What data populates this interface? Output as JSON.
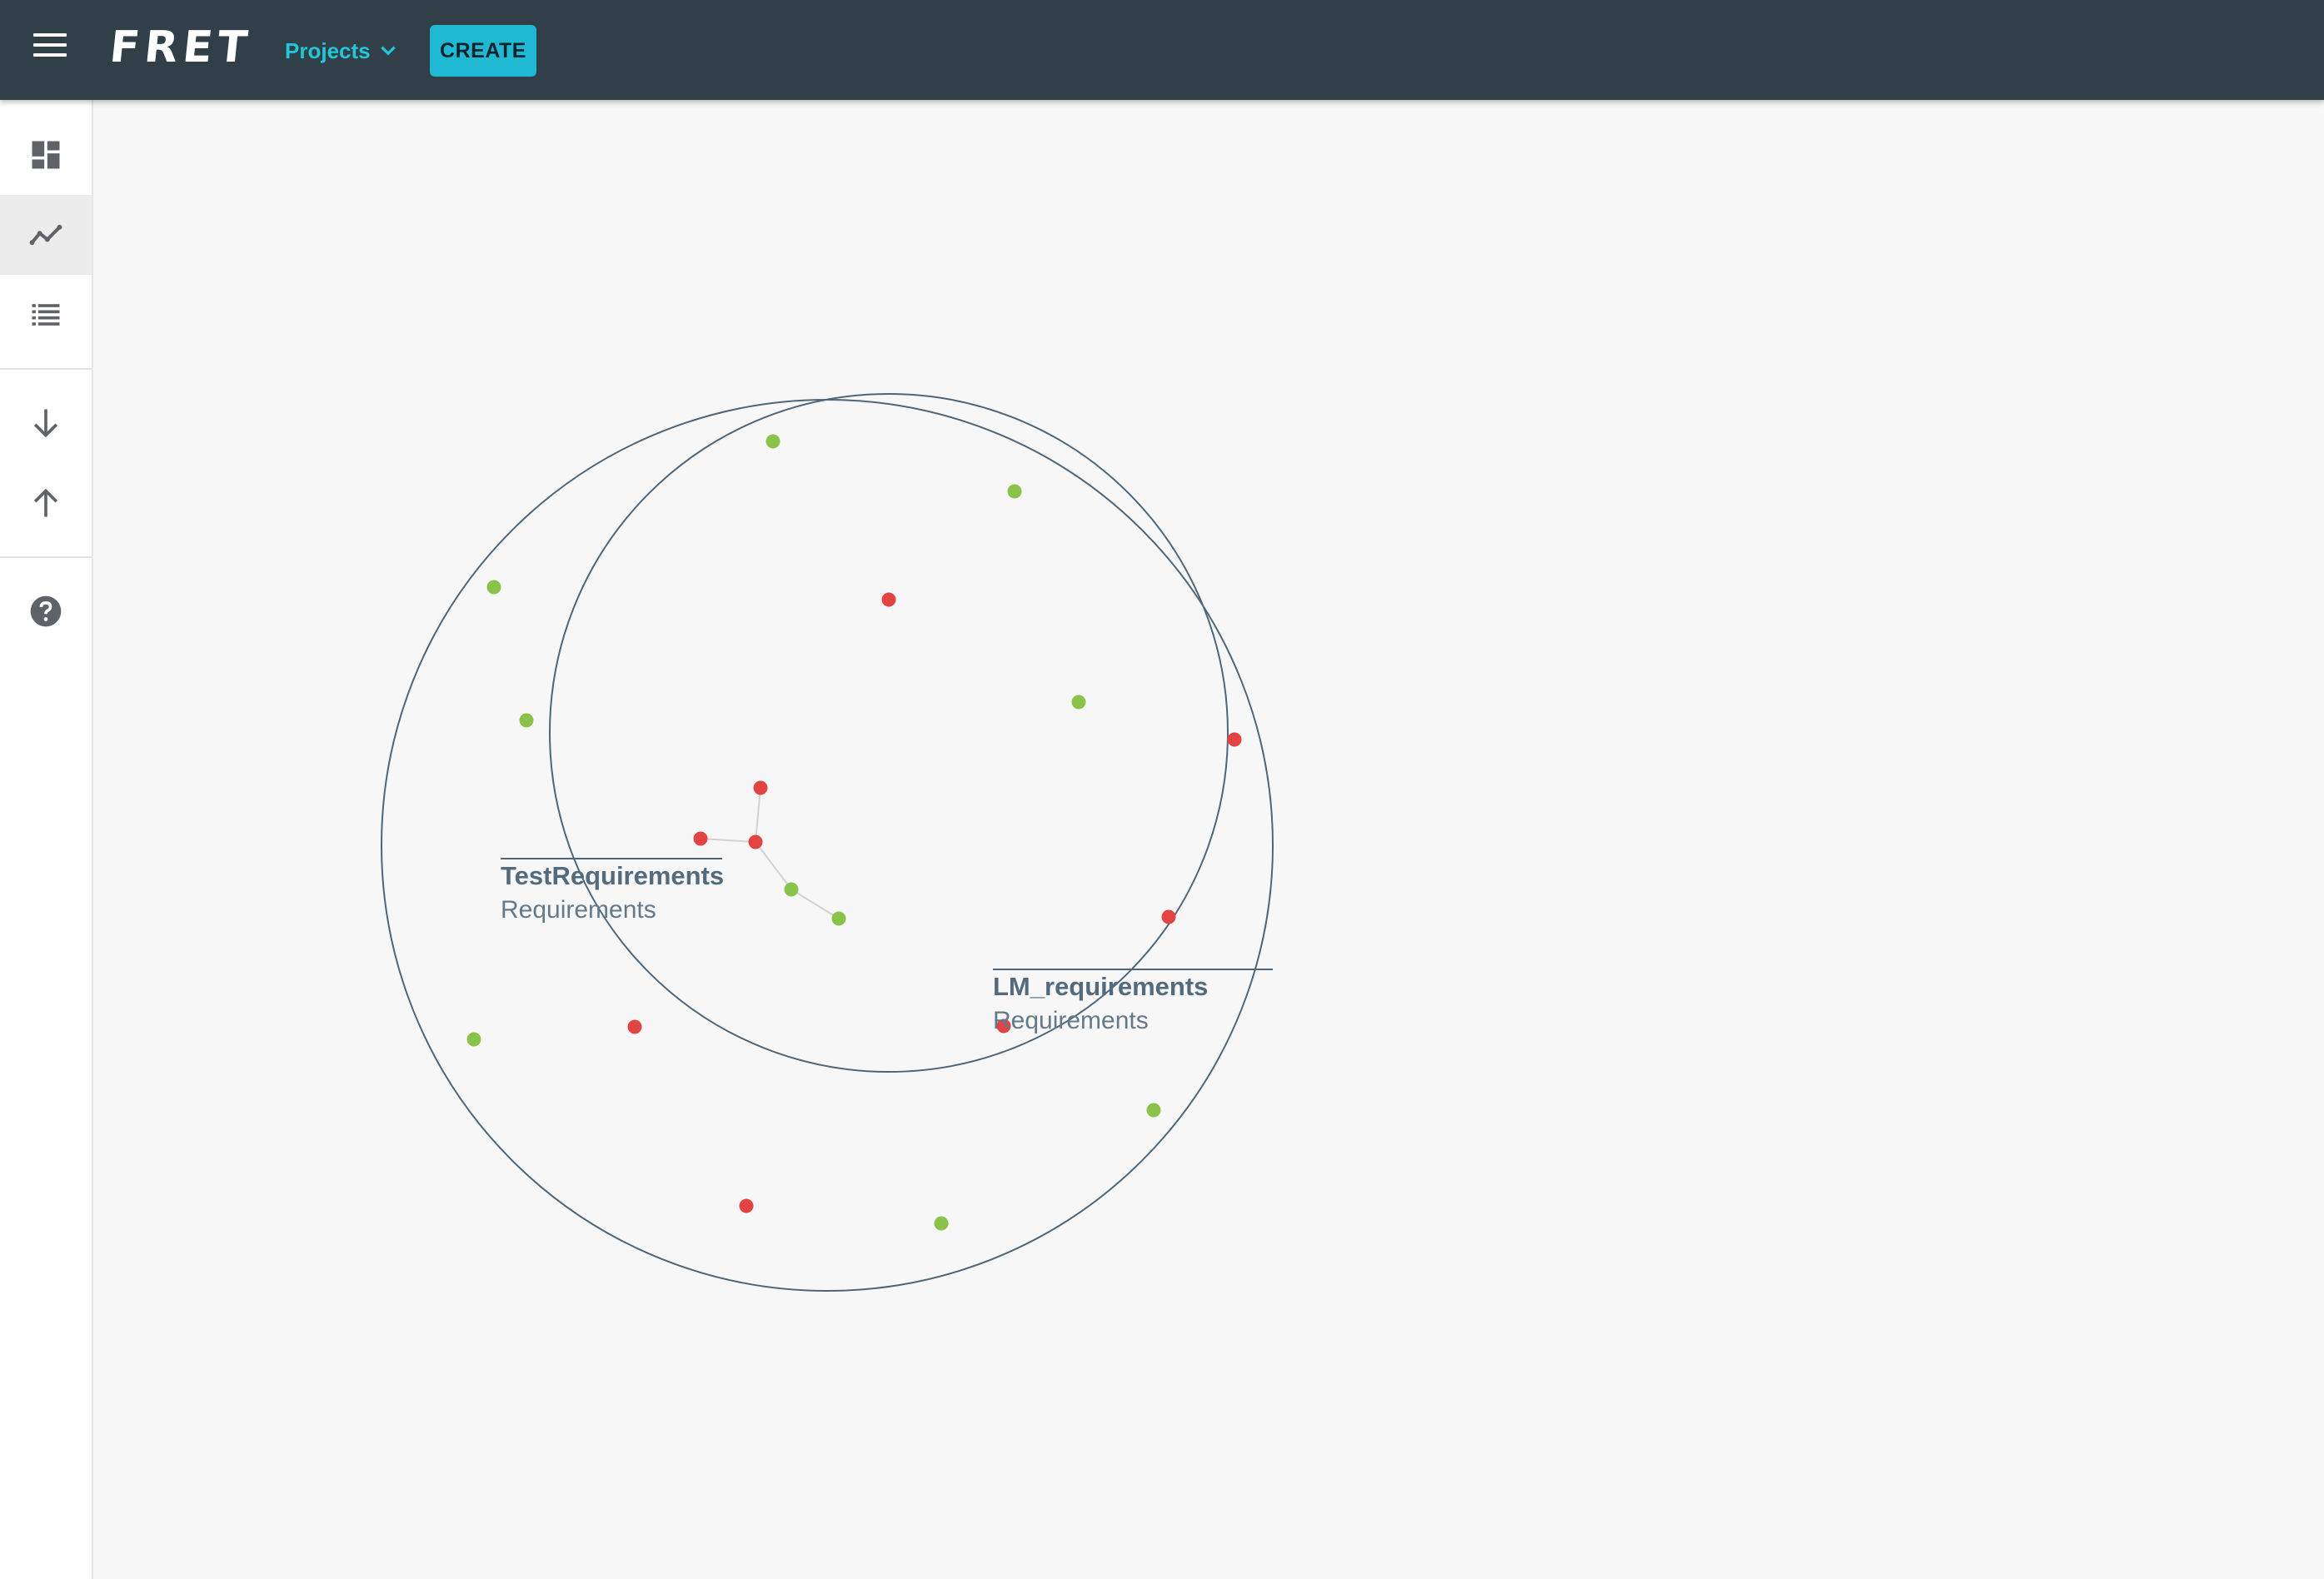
{
  "app": {
    "logo_text": "FRET",
    "projects_label": "Projects",
    "create_label": "CREATE",
    "colors": {
      "appbar": "#303f48",
      "accent": "#26c6da",
      "circle_stroke": "#4e6678",
      "requirement_red": "#e24444",
      "requirement_green": "#8bc34a"
    }
  },
  "sidebar": {
    "items": [
      {
        "name": "dashboard-icon",
        "active": false
      },
      {
        "name": "analysis-chart-icon",
        "active": true
      },
      {
        "name": "list-icon",
        "active": false
      },
      {
        "name": "import-arrow-down-icon",
        "active": false
      },
      {
        "name": "export-arrow-up-icon",
        "active": false
      },
      {
        "name": "help-icon",
        "active": false
      }
    ]
  },
  "clusters": [
    {
      "title": "TestRequirements",
      "subtitle": "Requirements"
    },
    {
      "title": "LM_requirements",
      "subtitle": "Requirements"
    }
  ]
}
